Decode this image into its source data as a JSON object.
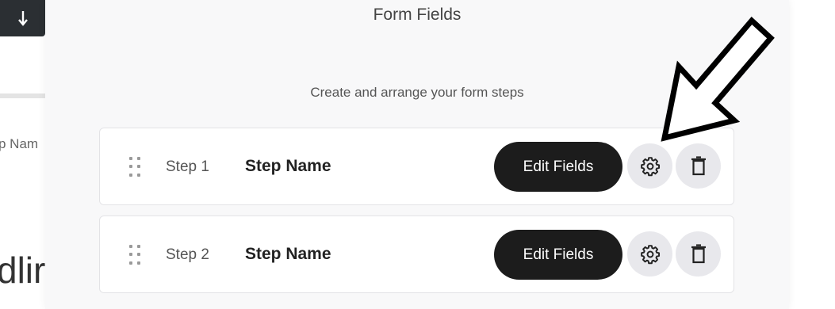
{
  "background": {
    "name_label": "p Nam",
    "headline_fragment": "dlir"
  },
  "modal": {
    "title": "Form Fields",
    "subtitle": "Create and arrange your form steps"
  },
  "steps": [
    {
      "number": "Step 1",
      "name": "Step Name",
      "edit_label": "Edit Fields"
    },
    {
      "number": "Step 2",
      "name": "Step Name",
      "edit_label": "Edit Fields"
    }
  ],
  "icons": {
    "download": "download-arrow-icon",
    "drag": "drag-handle-icon",
    "settings": "gear-icon",
    "delete": "trash-icon",
    "annotation": "annotation-arrow-icon"
  },
  "colors": {
    "primary_button": "#1c1c1c",
    "icon_button_bg": "#e8e8ec",
    "modal_bg": "#f8f8f9"
  }
}
